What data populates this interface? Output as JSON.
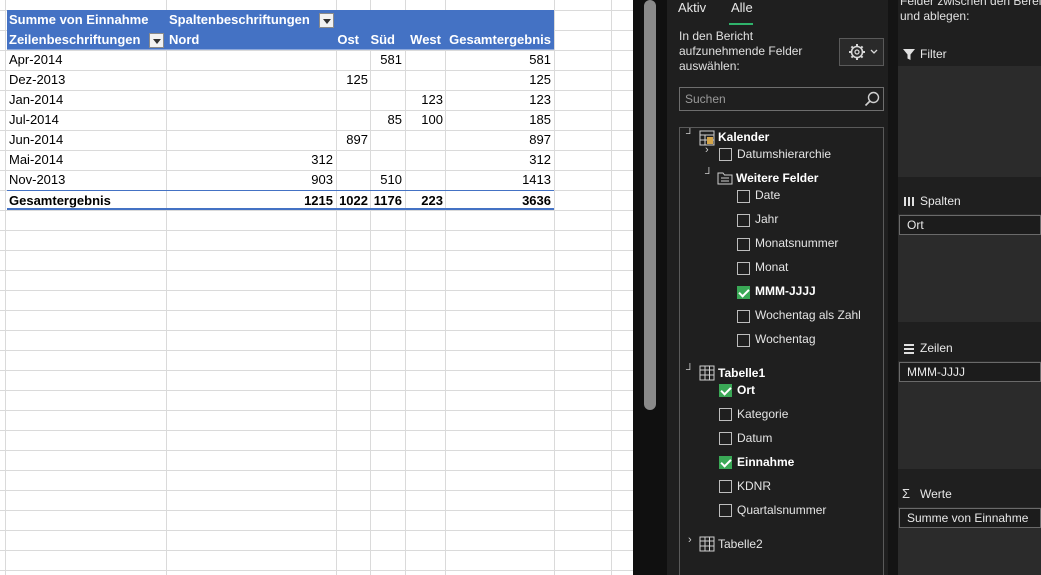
{
  "pivot": {
    "header1": {
      "corner": "Summe von Einnahme",
      "col_labels": "Spaltenbeschriftungen"
    },
    "header2": {
      "row_labels": "Zeilenbeschriftungen",
      "columns": [
        "Nord",
        "Ost",
        "Süd",
        "West",
        "Gesamtergebnis"
      ]
    },
    "rows": [
      {
        "label": "Apr-2014",
        "nord": "",
        "ost": "",
        "sued": "581",
        "west": "",
        "total": "581"
      },
      {
        "label": "Dez-2013",
        "nord": "",
        "ost": "125",
        "sued": "",
        "west": "",
        "total": "125"
      },
      {
        "label": "Jan-2014",
        "nord": "",
        "ost": "",
        "sued": "",
        "west": "123",
        "total": "123"
      },
      {
        "label": "Jul-2014",
        "nord": "",
        "ost": "",
        "sued": "85",
        "west": "100",
        "total": "185"
      },
      {
        "label": "Jun-2014",
        "nord": "",
        "ost": "897",
        "sued": "",
        "west": "",
        "total": "897"
      },
      {
        "label": "Mai-2014",
        "nord": "312",
        "ost": "",
        "sued": "",
        "west": "",
        "total": "312"
      },
      {
        "label": "Nov-2013",
        "nord": "903",
        "ost": "",
        "sued": "510",
        "west": "",
        "total": "1413"
      }
    ],
    "grand_total": {
      "label": "Gesamtergebnis",
      "nord": "1215",
      "ost": "1022",
      "sued": "1176",
      "west": "223",
      "total": "3636"
    }
  },
  "field_pane": {
    "tabs": {
      "active": "Aktiv",
      "all": "Alle"
    },
    "choose_text": "In den Bericht aufzunehmende Felder auswählen:",
    "search_placeholder": "Suchen",
    "kalender": {
      "name": "Kalender",
      "datumshierarchie": "Datumshierarchie",
      "weitere_felder": "Weitere Felder",
      "fields": [
        {
          "label": "Date",
          "checked": false
        },
        {
          "label": "Jahr",
          "checked": false
        },
        {
          "label": "Monatsnummer",
          "checked": false
        },
        {
          "label": "Monat",
          "checked": false
        },
        {
          "label": "MMM-JJJJ",
          "checked": true
        },
        {
          "label": "Wochentag als Zahl",
          "checked": false
        },
        {
          "label": "Wochentag",
          "checked": false
        }
      ]
    },
    "tabelle1": {
      "name": "Tabelle1",
      "fields": [
        {
          "label": "Ort",
          "checked": true
        },
        {
          "label": "Kategorie",
          "checked": false
        },
        {
          "label": "Datum",
          "checked": false
        },
        {
          "label": "Einnahme",
          "checked": true
        },
        {
          "label": "KDNR",
          "checked": false
        },
        {
          "label": "Quartalsnummer",
          "checked": false
        }
      ]
    },
    "tabelle2": {
      "name": "Tabelle2"
    }
  },
  "areas": {
    "top_text": "Felder zwischen den Bereic\nund ablegen:",
    "filter": {
      "title": "Filter"
    },
    "spalten": {
      "title": "Spalten",
      "chip": "Ort"
    },
    "zeilen": {
      "title": "Zeilen",
      "chip": "MMM-JJJJ"
    },
    "werte": {
      "title": "Werte",
      "chip": "Summe von Einnahme"
    }
  },
  "colors": {
    "pivot_header": "#4472c4",
    "pane_bg": "#1f1f1f",
    "check_green": "#3aa856",
    "tab_accent": "#2fb36b"
  }
}
